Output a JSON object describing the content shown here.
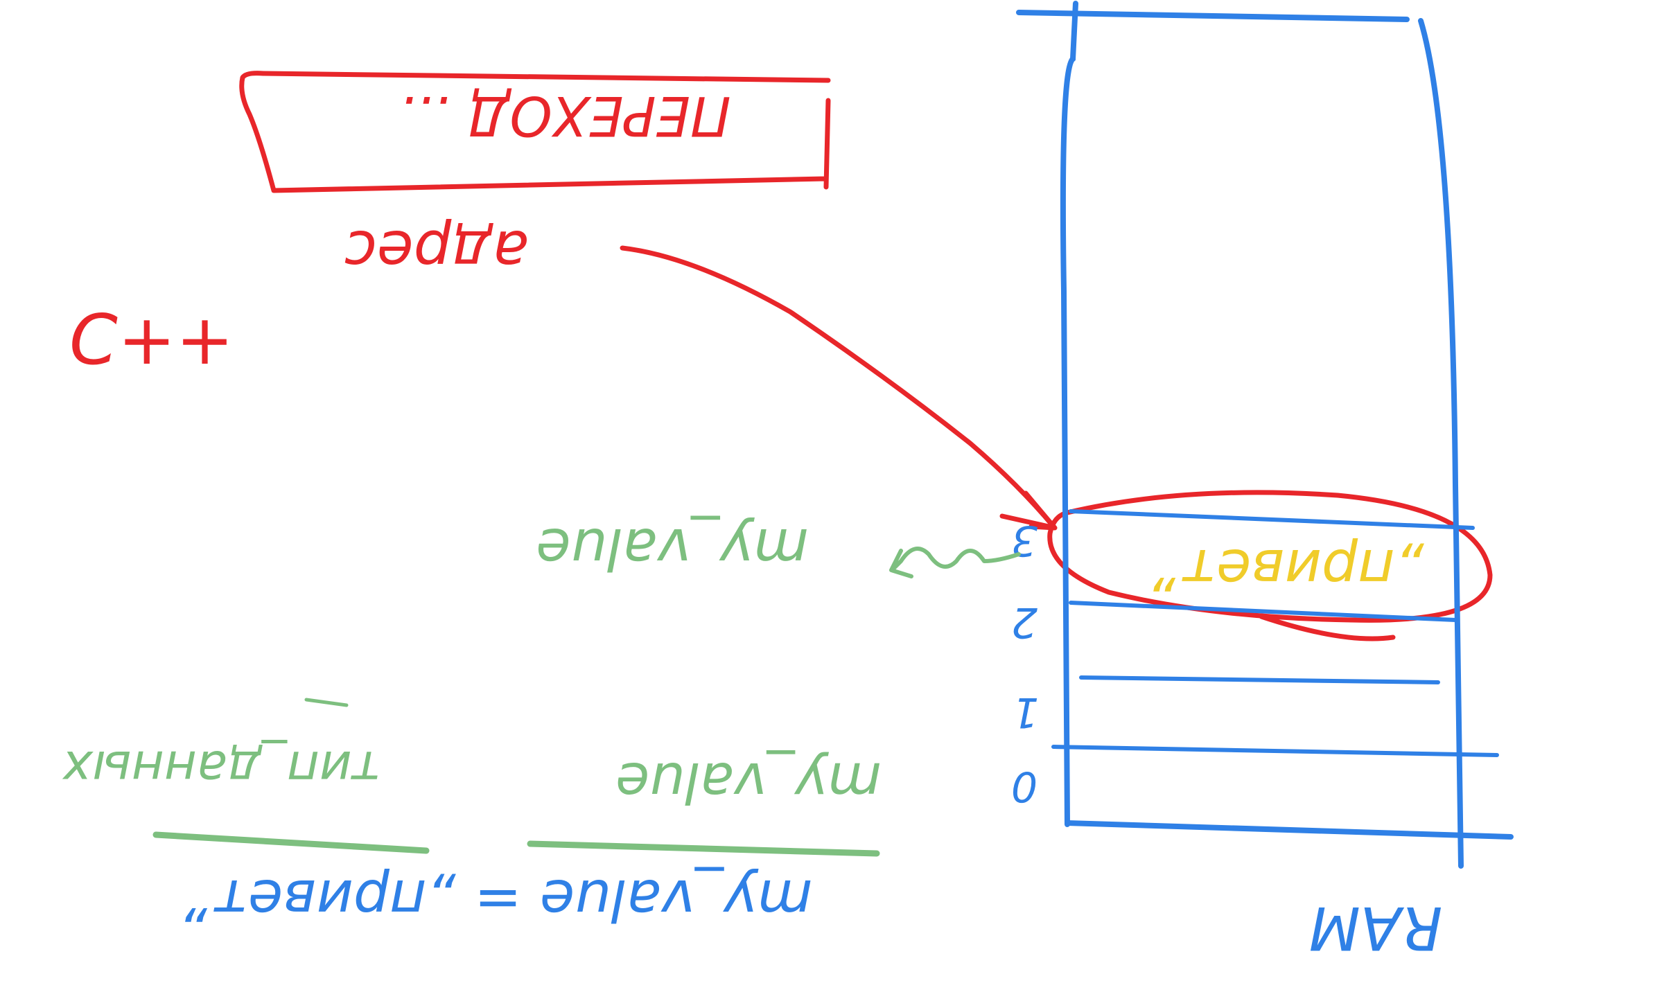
{
  "colors": {
    "background": "#ffffff",
    "red": "#e8262a",
    "blue": "#2f80e6",
    "green": "#7dbf7f",
    "yellow": "#f0cc2a"
  },
  "texts": {
    "cpp_label": "C++",
    "red_box_text": "ПЕРЕХОД ...",
    "red_label": "адрес",
    "cell_value": "„привет”",
    "green_label_right": "my_value",
    "green_label_left_1": "my_value",
    "green_label_left_2": "тип_данных",
    "assignment": "my_value = „привет”",
    "memory_label": "RAM"
  },
  "cell_indices": [
    "0",
    "1",
    "2",
    "3"
  ]
}
